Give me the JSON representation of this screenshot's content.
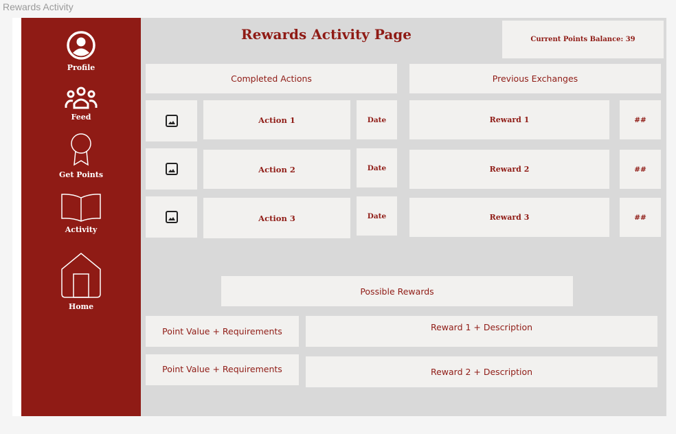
{
  "frame": {
    "label": "Rewards Activity"
  },
  "sidebar": {
    "items": [
      {
        "label": "Profile",
        "icon": "profile-icon"
      },
      {
        "label": "Feed",
        "icon": "people-icon"
      },
      {
        "label": "Get Points",
        "icon": "award-ribbon-icon"
      },
      {
        "label": "Activity",
        "icon": "open-book-icon"
      },
      {
        "label": "Home",
        "icon": "home-icon"
      }
    ]
  },
  "header": {
    "title": "Rewards Activity Page",
    "points_balance": "Current Points Balance: 39"
  },
  "completed_actions": {
    "heading": "Completed Actions",
    "rows": [
      {
        "action": "Action 1",
        "date": "Date"
      },
      {
        "action": "Action 2",
        "date": "Date"
      },
      {
        "action": "Action 3",
        "date": "Date"
      }
    ]
  },
  "previous_exchanges": {
    "heading": "Previous Exchanges",
    "rows": [
      {
        "reward": "Reward 1",
        "points": "##"
      },
      {
        "reward": "Reward 2",
        "points": "##"
      },
      {
        "reward": "Reward 3",
        "points": "##"
      }
    ]
  },
  "possible_rewards": {
    "heading": "Possible Rewards",
    "rows": [
      {
        "requirements": "Point Value + Requirements",
        "description": "Reward 1 + Description"
      },
      {
        "requirements": "Point Value + Requirements",
        "description": "Reward 2 + Description"
      }
    ]
  },
  "colors": {
    "accent": "#8f1b15",
    "panel": "#d9d9d9",
    "card": "#f2f1ef"
  }
}
